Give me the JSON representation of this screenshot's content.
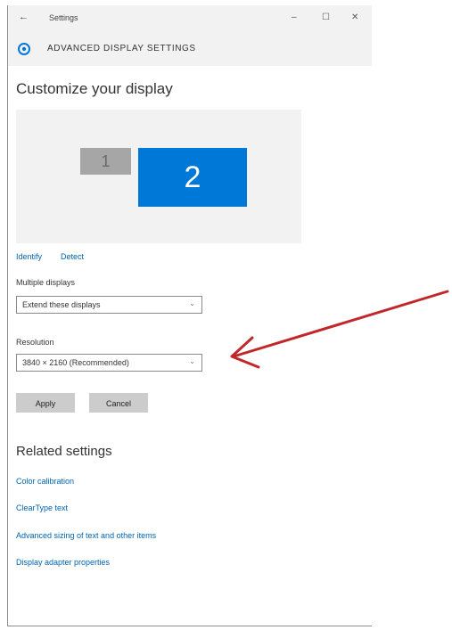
{
  "titlebar": {
    "back_glyph": "←",
    "title": "Settings",
    "min_glyph": "–",
    "max_glyph": "☐",
    "close_glyph": "✕"
  },
  "header": {
    "icon": "gear-icon",
    "text": "ADVANCED DISPLAY SETTINGS"
  },
  "main": {
    "heading": "Customize your display",
    "monitors": [
      "1",
      "2"
    ],
    "identify_link": "Identify",
    "detect_link": "Detect",
    "multiple_displays_label": "Multiple displays",
    "multiple_displays_value": "Extend these displays",
    "resolution_label": "Resolution",
    "resolution_value": "3840 × 2160 (Recommended)",
    "apply_label": "Apply",
    "cancel_label": "Cancel",
    "chevron_glyph": "⌄"
  },
  "related": {
    "heading": "Related settings",
    "links": [
      "Color calibration",
      "ClearType text",
      "Advanced sizing of text and other items",
      "Display adapter properties"
    ]
  },
  "annotation": {
    "arrow_color": "#c0282a"
  },
  "colors": {
    "accent": "#0078d7",
    "link": "#0063b1",
    "secondary_monitor": "#a6a6a6"
  }
}
